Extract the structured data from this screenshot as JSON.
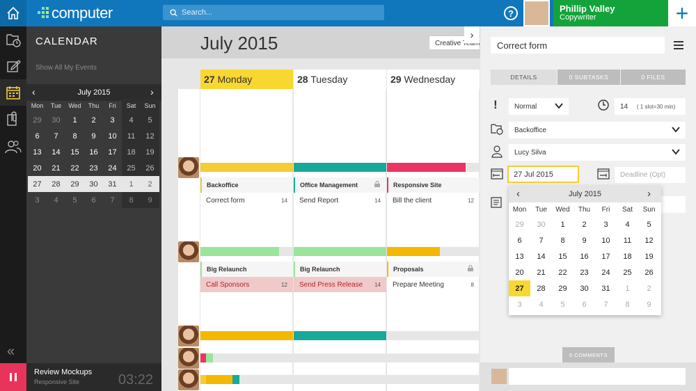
{
  "topbar": {
    "logo": "computer",
    "search_placeholder": "Search...",
    "user_name": "Phillip Valley",
    "user_role": "Copywriter",
    "help": "?",
    "add": "+"
  },
  "sidebar": {
    "title": "CALENDAR",
    "show_all": "Show All My Events",
    "mini_month": "July 2015",
    "weekdays": [
      "Mon",
      "Tue",
      "Wed",
      "Thu",
      "Fri",
      "Sat",
      "Sun"
    ],
    "weeks": [
      [
        "29",
        "30",
        "1",
        "2",
        "3",
        "4",
        "5"
      ],
      [
        "6",
        "7",
        "8",
        "9",
        "10",
        "11",
        "12"
      ],
      [
        "13",
        "14",
        "15",
        "16",
        "17",
        "18",
        "19"
      ],
      [
        "20",
        "21",
        "22",
        "23",
        "24",
        "25",
        "26"
      ],
      [
        "27",
        "28",
        "29",
        "30",
        "31",
        "1",
        "2"
      ],
      [
        "3",
        "4",
        "5",
        "6",
        "7",
        "8",
        "9"
      ]
    ],
    "current_week": 4,
    "timer": {
      "task": "Review Mockups",
      "project": "Responsive Site",
      "time": "03:22"
    }
  },
  "calendar": {
    "month": "July 2015",
    "team_button": "Creative Team",
    "days": [
      {
        "num": "27",
        "name": "Monday",
        "today": true
      },
      {
        "num": "28",
        "name": "Tuesday",
        "today": false
      },
      {
        "num": "29",
        "name": "Wednesday",
        "today": false
      }
    ],
    "rows": [
      {
        "tasks": [
          {
            "project": "Backoffice",
            "task": "Correct form",
            "count": "14",
            "color": "#f3cc36",
            "progress": 1.0,
            "locked": false,
            "highlight": false
          },
          {
            "project": "Office Management",
            "task": "Send Report",
            "count": "14",
            "color": "#17a99a",
            "progress": 1.0,
            "locked": true,
            "highlight": false
          },
          {
            "project": "Responsive Site",
            "task": "Bill the client",
            "count": "12",
            "color": "#ea3562",
            "progress": 0.85,
            "locked": false,
            "highlight": false
          }
        ]
      },
      {
        "tasks": [
          {
            "project": "Big Relaunch",
            "task": "Call Sponsors",
            "count": "12",
            "color": "#9ae59a",
            "progress": 0.85,
            "locked": false,
            "highlight": true
          },
          {
            "project": "Big Relaunch",
            "task": "Send Press Release",
            "count": "14",
            "color": "#9ae59a",
            "progress": 1.0,
            "locked": false,
            "highlight": true
          },
          {
            "project": "Proposals",
            "task": "Prepare Meeting",
            "count": "8",
            "color": "#f5b800",
            "progress": 0.57,
            "locked": true,
            "highlight": false
          }
        ]
      }
    ]
  },
  "detail": {
    "title": "Correct form",
    "tabs": [
      "DETAILS",
      "0 SUBTASKS",
      "0 FILES"
    ],
    "priority": "Normal",
    "priority_icon": "!",
    "slots": "14",
    "slot_hint": "( 1 slot=30 min)",
    "project": "Backoffice",
    "assignee": "Lucy Silva",
    "date": "27 Jul 2015",
    "deadline_placeholder": "Deadline (Opt)",
    "popup_month": "July 2015",
    "popup_weekdays": [
      "Mon",
      "Tue",
      "Wed",
      "Thu",
      "Fri",
      "Sat",
      "Sun"
    ],
    "popup_weeks": [
      [
        "29",
        "30",
        "1",
        "2",
        "3",
        "4",
        "5"
      ],
      [
        "6",
        "7",
        "8",
        "9",
        "10",
        "11",
        "12"
      ],
      [
        "13",
        "14",
        "15",
        "16",
        "17",
        "18",
        "19"
      ],
      [
        "20",
        "21",
        "22",
        "23",
        "24",
        "25",
        "26"
      ],
      [
        "27",
        "28",
        "29",
        "30",
        "31",
        "1",
        "2"
      ],
      [
        "3",
        "4",
        "5",
        "6",
        "7",
        "8",
        "9"
      ]
    ],
    "comments": "0 COMMENTS"
  },
  "colors": {
    "brand_blue": "#1077bd",
    "green": "#14a33a",
    "today_yellow": "#f3cc36",
    "pink": "#e8335a"
  }
}
